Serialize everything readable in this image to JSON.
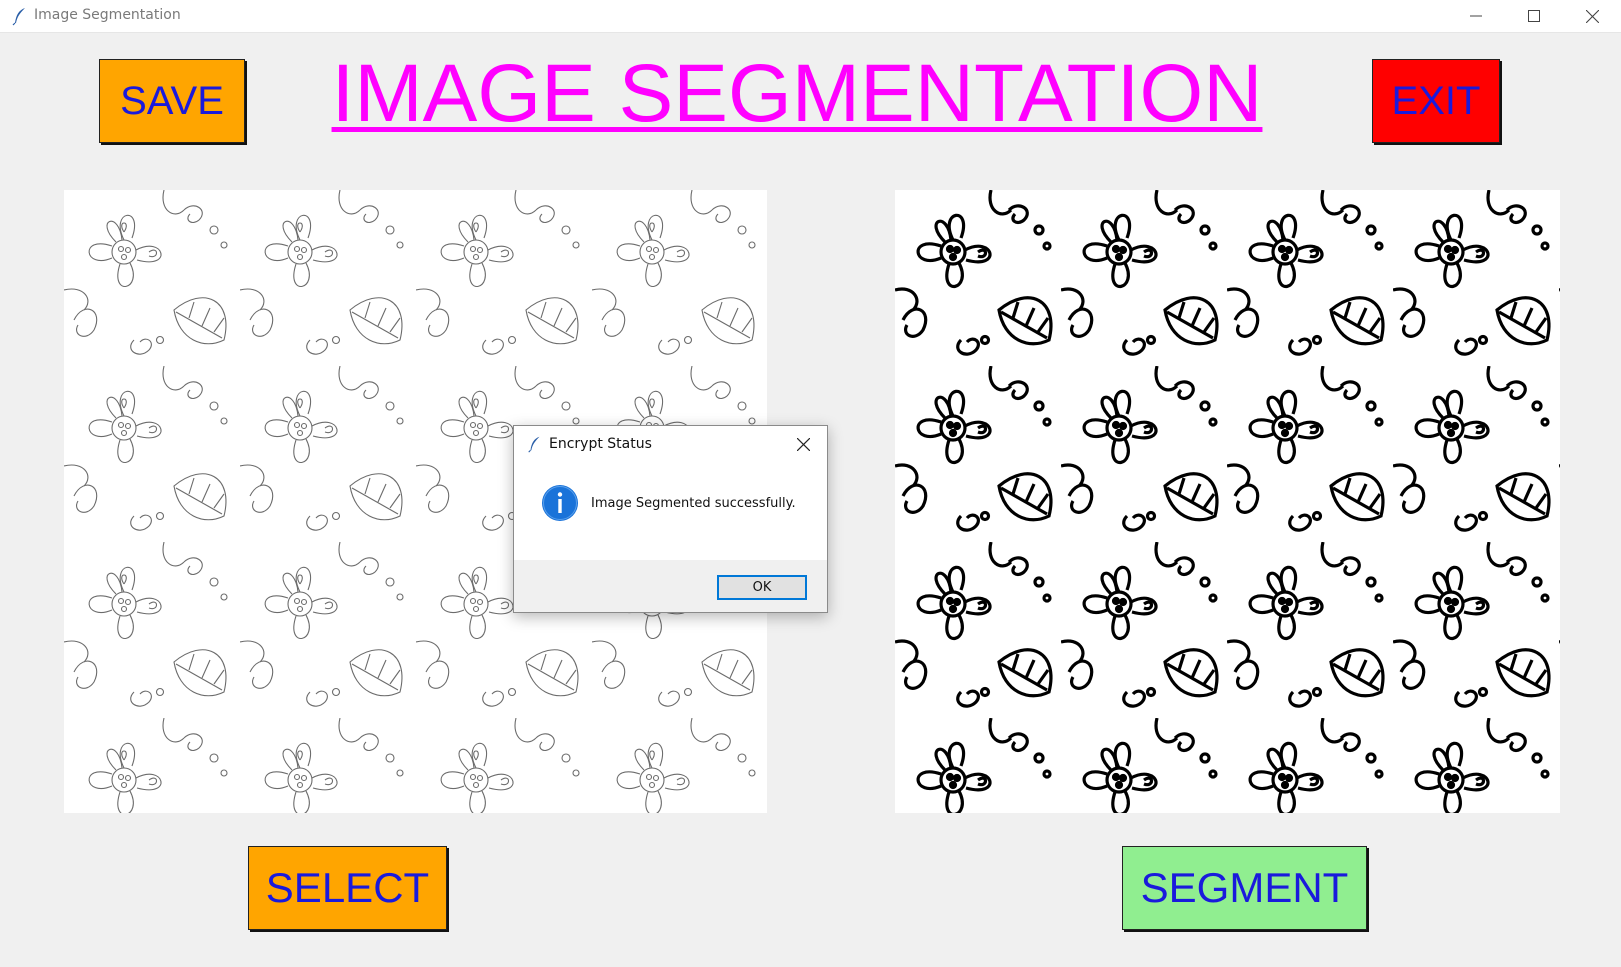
{
  "window": {
    "title": "Image Segmentation",
    "icon": "feather-icon",
    "controls": [
      "minimize-icon",
      "maximize-icon",
      "close-icon"
    ]
  },
  "header": {
    "save_label": "SAVE",
    "title": "IMAGE SEGMENTATION",
    "exit_label": "EXIT"
  },
  "images": {
    "original": "floral-lineart-original-image",
    "segmented": "floral-lineart-segmented-image"
  },
  "footer": {
    "select_label": "SELECT",
    "segment_label": "SEGMENT"
  },
  "dialog": {
    "title": "Encrypt Status",
    "icon": "info-icon",
    "message": "Image Segmented successfully.",
    "ok_label": "OK"
  },
  "colors": {
    "save_button": "#ffa500",
    "select_button": "#ffa500",
    "exit_button": "#ff0000",
    "segment_button": "#90ee90",
    "button_text": "#1a1adc",
    "title_text": "#ff00ff",
    "background": "#f0f0f0"
  }
}
